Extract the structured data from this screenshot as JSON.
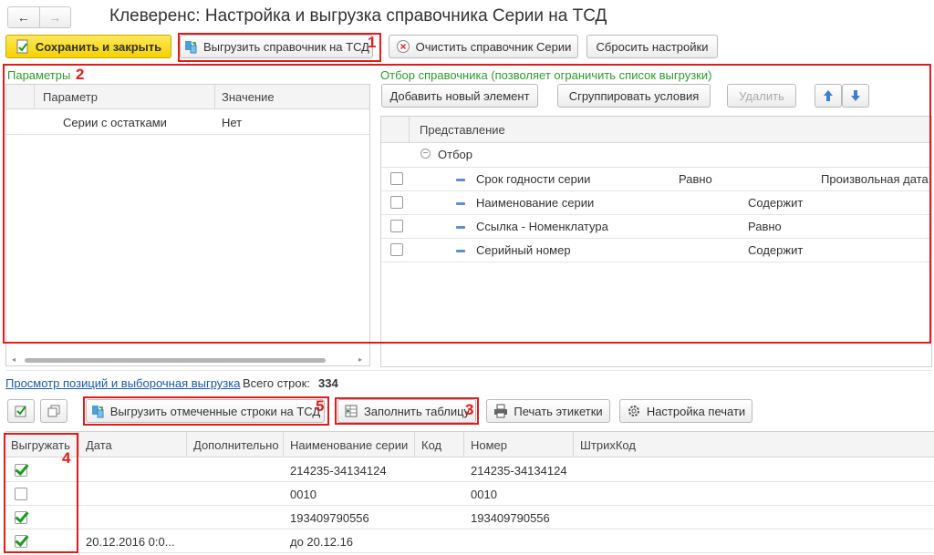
{
  "window": {
    "title": "Клеверенс: Настройка и выгрузка справочника Серии на ТСД",
    "nav_back": "←",
    "nav_forward": "→"
  },
  "toolbar": {
    "save_close": "Сохранить и закрыть",
    "export_tsd": "Выгрузить справочник на ТСД",
    "clear_series": "Очистить справочник Серии",
    "reset_settings": "Сбросить настройки"
  },
  "params": {
    "title": "Параметры",
    "columns": [
      "Параметр",
      "Значение"
    ],
    "rows": [
      {
        "param": "Серии с остатками",
        "value": "Нет"
      }
    ]
  },
  "filter": {
    "title": "Отбор справочника (позволяет ограничить список выгрузки)",
    "add_element": "Добавить новый элемент",
    "group_conditions": "Сгруппировать условия",
    "delete": "Удалить",
    "column": "Представление",
    "group_label": "Отбор",
    "rows": [
      {
        "name": "Срок годности серии",
        "condition": "Равно",
        "value": "Произвольная дата"
      },
      {
        "name": "Наименование серии",
        "condition": "Содержит",
        "value": ""
      },
      {
        "name": "Ссылка - Номенклатура",
        "condition": "Равно",
        "value": ""
      },
      {
        "name": "Серийный номер",
        "condition": "Содержит",
        "value": ""
      }
    ]
  },
  "preview": {
    "link": "Просмотр позиций и выборочная выгрузка",
    "total_label": "Всего строк:",
    "total_value": "334",
    "export_marked": "Выгрузить отмеченные строки на ТСД",
    "fill_table": "Заполнить таблицу",
    "print_labels": "Печать этикетки",
    "print_settings": "Настройка печати",
    "columns": [
      "Выгружать",
      "Дата",
      "Дополнительно",
      "Наименование серии",
      "Код",
      "Номер",
      "ШтрихКод"
    ],
    "rows": [
      {
        "checked": true,
        "date": "",
        "extra": "",
        "name": "214235-34134124",
        "code": "",
        "number": "214235-34134124",
        "barcode": ""
      },
      {
        "checked": false,
        "date": "",
        "extra": "",
        "name": "0010",
        "code": "",
        "number": "0010",
        "barcode": ""
      },
      {
        "checked": true,
        "date": "",
        "extra": "",
        "name": "193409790556",
        "code": "",
        "number": "193409790556",
        "barcode": ""
      },
      {
        "checked": true,
        "date": "20.12.2016 0:0...",
        "extra": "",
        "name": "до 20.12.16",
        "code": "",
        "number": "",
        "barcode": ""
      }
    ]
  },
  "annotations": [
    "1",
    "2",
    "3",
    "4",
    "5"
  ],
  "colors": {
    "accent_red": "#e31b1b",
    "save_yellow": "#f5d200",
    "link_green": "#2d9a2d",
    "link_blue": "#1a5aa8"
  }
}
